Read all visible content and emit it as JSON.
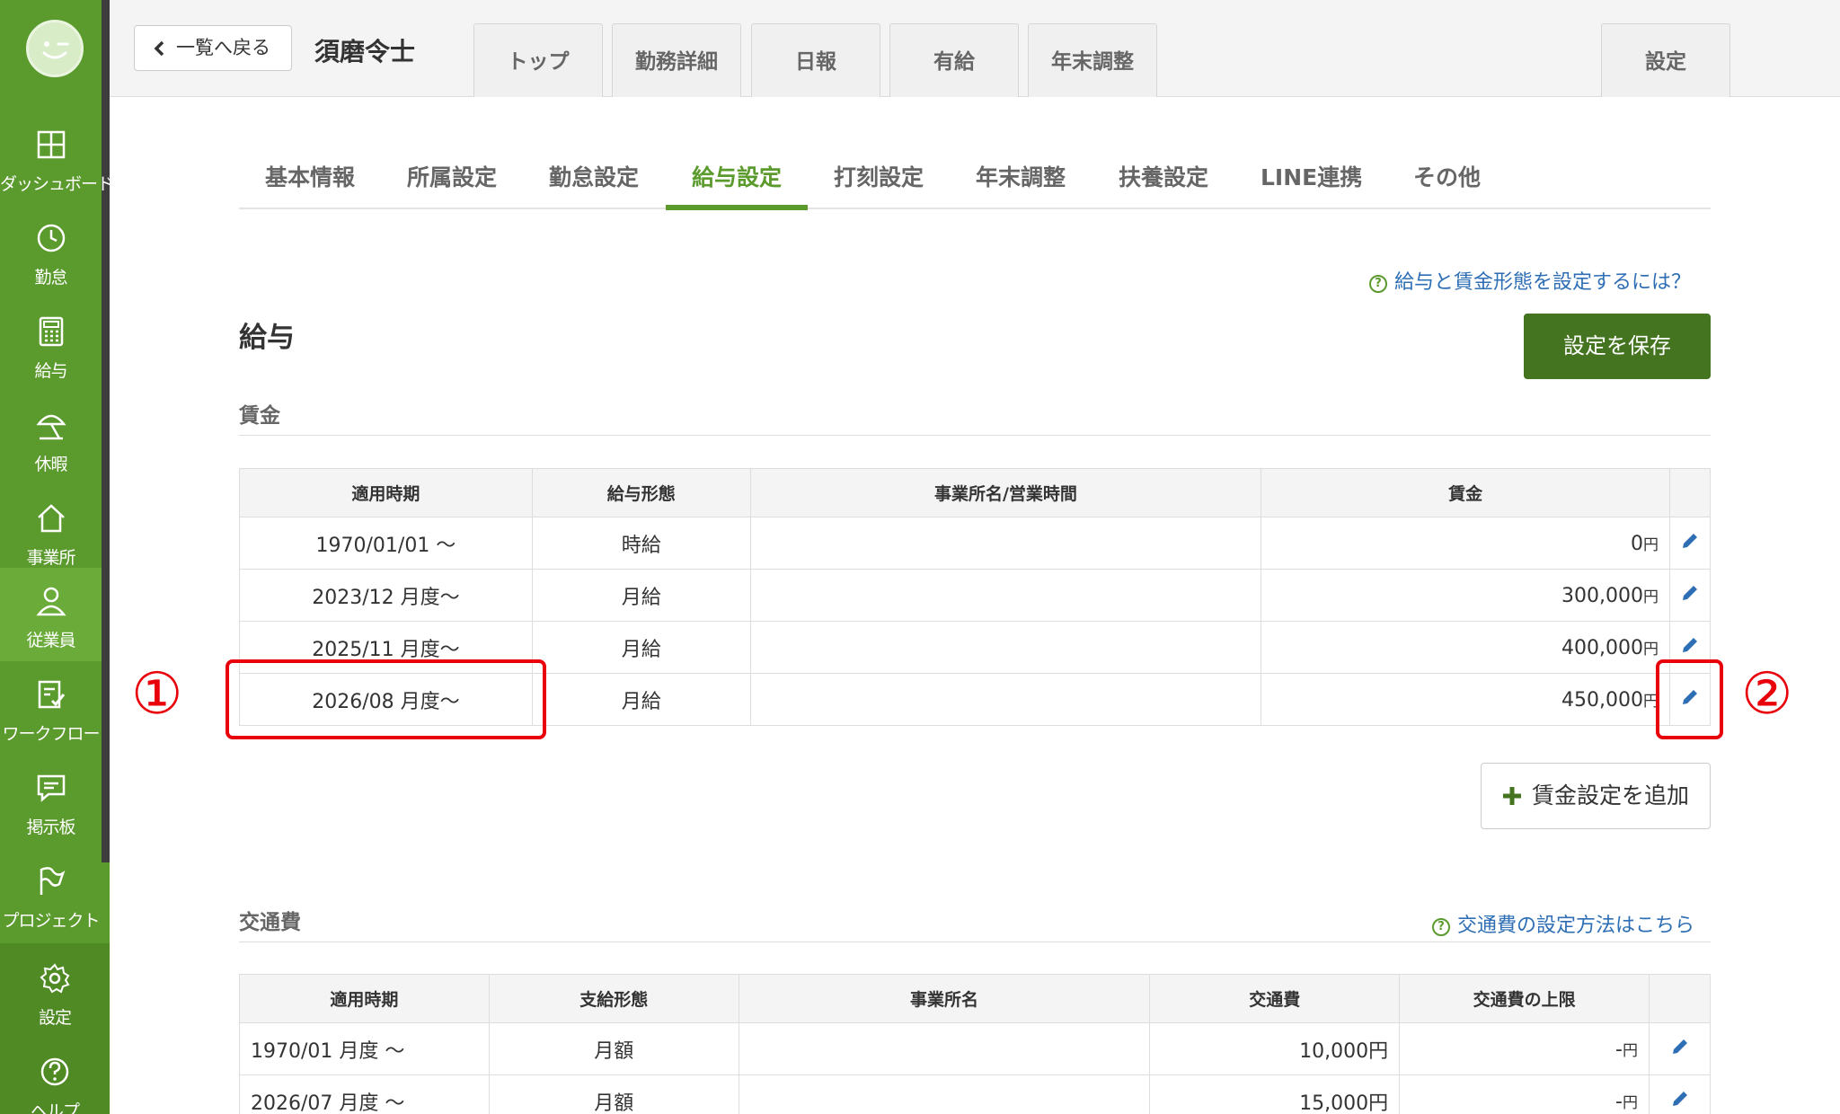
{
  "sidebar": {
    "logo_icon": "smiley-logo-icon",
    "items": [
      {
        "label": "ダッシュボード",
        "icon": "dashboard-icon"
      },
      {
        "label": "勤怠",
        "icon": "clock-icon"
      },
      {
        "label": "給与",
        "icon": "calculator-icon"
      },
      {
        "label": "休暇",
        "icon": "parasol-icon"
      },
      {
        "label": "事業所",
        "icon": "home-icon"
      },
      {
        "label": "従業員",
        "icon": "person-icon"
      },
      {
        "label": "ワークフロー",
        "icon": "workflow-icon"
      },
      {
        "label": "掲示板",
        "icon": "chat-icon"
      },
      {
        "label": "プロジェクト",
        "icon": "flag-icon"
      },
      {
        "label": "設定",
        "icon": "gear-icon"
      },
      {
        "label": "ヘルプ",
        "icon": "help-icon"
      }
    ],
    "active_index": 5
  },
  "header": {
    "back_label": "一覧へ戻る",
    "employee_name": "須磨令士",
    "tabs": [
      "トップ",
      "勤務詳細",
      "日報",
      "有給",
      "年末調整"
    ],
    "settings_tab": "設定"
  },
  "subtabs": {
    "items": [
      "基本情報",
      "所属設定",
      "勤怠設定",
      "給与設定",
      "打刻設定",
      "年末調整",
      "扶養設定",
      "LINE連携",
      "その他"
    ],
    "active_index": 3
  },
  "salary": {
    "help_link": "給与と賃金形態を設定するには？",
    "title": "給与",
    "save_label": "設定を保存",
    "wage_section": "賃金",
    "table": {
      "headers": [
        "適用時期",
        "給与形態",
        "事業所名/営業時間",
        "賃金"
      ],
      "rows": [
        {
          "period": "1970/01/01 〜",
          "type": "時給",
          "office": "",
          "amount": "0",
          "unit": "円"
        },
        {
          "period": "2023/12 月度〜",
          "type": "月給",
          "office": "",
          "amount": "300,000",
          "unit": "円"
        },
        {
          "period": "2025/11 月度〜",
          "type": "月給",
          "office": "",
          "amount": "400,000",
          "unit": "円"
        },
        {
          "period": "2026/08 月度〜",
          "type": "月給",
          "office": "",
          "amount": "450,000",
          "unit": "円"
        }
      ]
    },
    "add_label": "賃金設定を追加"
  },
  "transport": {
    "title": "交通費",
    "help_link": "交通費の設定方法はこちら",
    "table": {
      "headers": [
        "適用時期",
        "支給形態",
        "事業所名",
        "交通費",
        "交通費の上限"
      ],
      "rows": [
        {
          "period": "1970/01 月度 〜",
          "type": "月額",
          "office": "",
          "amount": "10,000",
          "unit": "円",
          "limit": "-",
          "limit_unit": "円"
        },
        {
          "period": "2026/07 月度 〜",
          "type": "月額",
          "office": "",
          "amount": "15,000",
          "unit": "円",
          "limit": "-",
          "limit_unit": "円"
        }
      ]
    }
  },
  "annotations": {
    "marker1": "①",
    "marker2": "②",
    "color": "#e8000b"
  },
  "colors": {
    "sidebar": "#5b9a2d",
    "accent": "#5b9a2d",
    "save_button": "#44741f",
    "link": "#2e6eb5"
  }
}
